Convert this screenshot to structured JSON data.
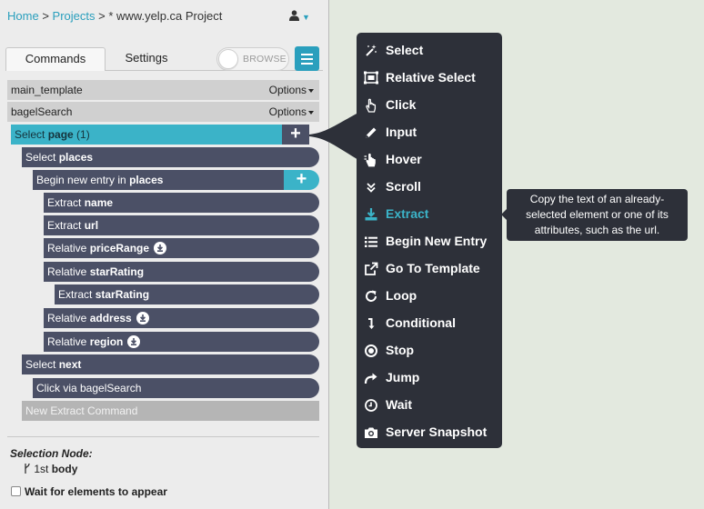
{
  "breadcrumb": {
    "home": "Home",
    "sep1": ">",
    "projects": "Projects",
    "sep2": ">",
    "project": "* www.yelp.ca Project"
  },
  "tabs": {
    "commands": "Commands",
    "settings": "Settings"
  },
  "browse_label": "BROWSE",
  "templates": [
    {
      "name": "main_template",
      "options": "Options"
    },
    {
      "name": "bagelSearch",
      "options": "Options"
    }
  ],
  "commands": {
    "select_page": {
      "pre": "Select ",
      "bold": "page",
      "post": " (1)"
    },
    "select_places": {
      "pre": "Select ",
      "bold": "places"
    },
    "begin_entry": {
      "pre": "Begin new entry in ",
      "bold": "places"
    },
    "extract_name": {
      "pre": "Extract ",
      "bold": "name"
    },
    "extract_url": {
      "pre": "Extract ",
      "bold": "url"
    },
    "rel_price": {
      "pre": "Relative ",
      "bold": "priceRange"
    },
    "rel_star": {
      "pre": "Relative ",
      "bold": "starRating"
    },
    "extract_star": {
      "pre": "Extract ",
      "bold": "starRating"
    },
    "rel_address": {
      "pre": "Relative ",
      "bold": "address"
    },
    "rel_region": {
      "pre": "Relative ",
      "bold": "region"
    },
    "select_next": {
      "pre": "Select ",
      "bold": "next"
    },
    "click_via": "Click via bagelSearch",
    "new_extract": "New Extract Command"
  },
  "selection_node": {
    "title": "Selection Node:",
    "prefix": "1st",
    "value": "body"
  },
  "wait_label": "Wait for elements to appear",
  "menu": [
    {
      "label": "Select",
      "icon": "magic-wand-icon"
    },
    {
      "label": "Relative Select",
      "icon": "relative-select-icon"
    },
    {
      "label": "Click",
      "icon": "pointer-hand-icon"
    },
    {
      "label": "Input",
      "icon": "pencil-icon"
    },
    {
      "label": "Hover",
      "icon": "hover-hand-icon"
    },
    {
      "label": "Scroll",
      "icon": "double-chevron-down-icon"
    },
    {
      "label": "Extract",
      "icon": "download-icon"
    },
    {
      "label": "Begin New Entry",
      "icon": "list-icon"
    },
    {
      "label": "Go To Template",
      "icon": "external-link-icon"
    },
    {
      "label": "Loop",
      "icon": "loop-icon"
    },
    {
      "label": "Conditional",
      "icon": "conditional-arrow-icon"
    },
    {
      "label": "Stop",
      "icon": "stop-icon"
    },
    {
      "label": "Jump",
      "icon": "share-arrow-icon"
    },
    {
      "label": "Wait",
      "icon": "clock-icon"
    },
    {
      "label": "Server Snapshot",
      "icon": "camera-icon"
    }
  ],
  "tooltip": "Copy the text of an already-selected element or one of its attributes, such as the url.",
  "colors": {
    "accent": "#3bb3c8",
    "command": "#4b5066",
    "popup": "#2d3039",
    "link": "#2a9fbd"
  }
}
